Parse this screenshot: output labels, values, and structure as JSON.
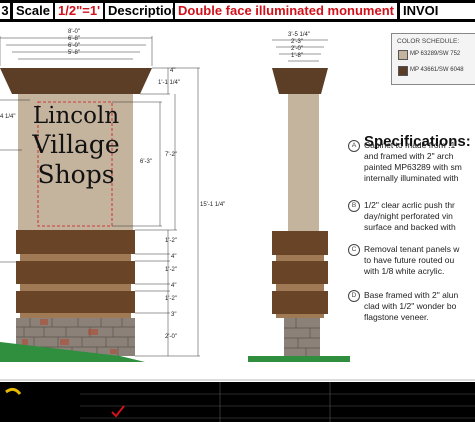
{
  "title_bar": {
    "left_fragment": "3",
    "scale_label": "Scale",
    "scale_value": "1/2\"=1'",
    "description_label": "Description",
    "description_value": "Double face illuminated monument",
    "invoice_label": "INVOI"
  },
  "sign_face": {
    "line1": "Lincoln",
    "line2": "Village",
    "line3": "Shops"
  },
  "front_dimensions": {
    "overall_width": "8'-0\"",
    "width_2": "6'-8\"",
    "width_3": "6'-0\"",
    "width_4": "5'-8\"",
    "cap_height_top": "4\"",
    "cap_height": "1'-1 1/4\"",
    "cabinet_height": "7'-2\"",
    "panel_height": "6'-3\"",
    "panel_width_fragment": "4 1/4\"",
    "overall_height": "15'-1 1/4\"",
    "base_band_1": "1'-2\"",
    "base_gap_1": "4\"",
    "base_band_2": "1'-2\"",
    "base_gap_2": "4\"",
    "base_band_3": "1'-2\"",
    "base_gap_3": "3\"",
    "stone_height": "2'-0\""
  },
  "side_dimensions": {
    "width_1": "3'-5 1/4\"",
    "width_2": "2'-3\"",
    "width_3": "2'-0\"",
    "width_4": "1'-8\""
  },
  "color_schedule": {
    "title": "COLOR SCHEDULE:",
    "items": [
      {
        "label": "MP 63289/SW 752",
        "color": "#c4b39d"
      },
      {
        "label": "MP 43661/SW 6048",
        "color": "#5b3e25"
      }
    ]
  },
  "specifications": {
    "title": "Specifications:",
    "items": [
      {
        "letter": "A",
        "lines": [
          "Cabinet to made from .1",
          "and framed with 2\" arch",
          "painted MP63289 with sm",
          "internally illuminated with"
        ]
      },
      {
        "letter": "B",
        "lines": [
          "1/2\" clear acrlic push thr",
          "day/night perforated vin",
          "surface and backed with"
        ]
      },
      {
        "letter": "C",
        "lines": [
          "Removal tenant panels w",
          "to have future routed ou",
          "with 1/8 white acrylic."
        ]
      },
      {
        "letter": "D",
        "lines": [
          "Base framed with 2\" alun",
          "clad with 1/2\" wonder bo",
          "flagstone veneer."
        ]
      }
    ]
  },
  "colors": {
    "cabinet": "#c4b39d",
    "cap": "#5b3e25",
    "base_band": "#6a4426",
    "stone": "#8b8178",
    "grass": "#2f8f3f",
    "title_red": "#d1111b"
  }
}
